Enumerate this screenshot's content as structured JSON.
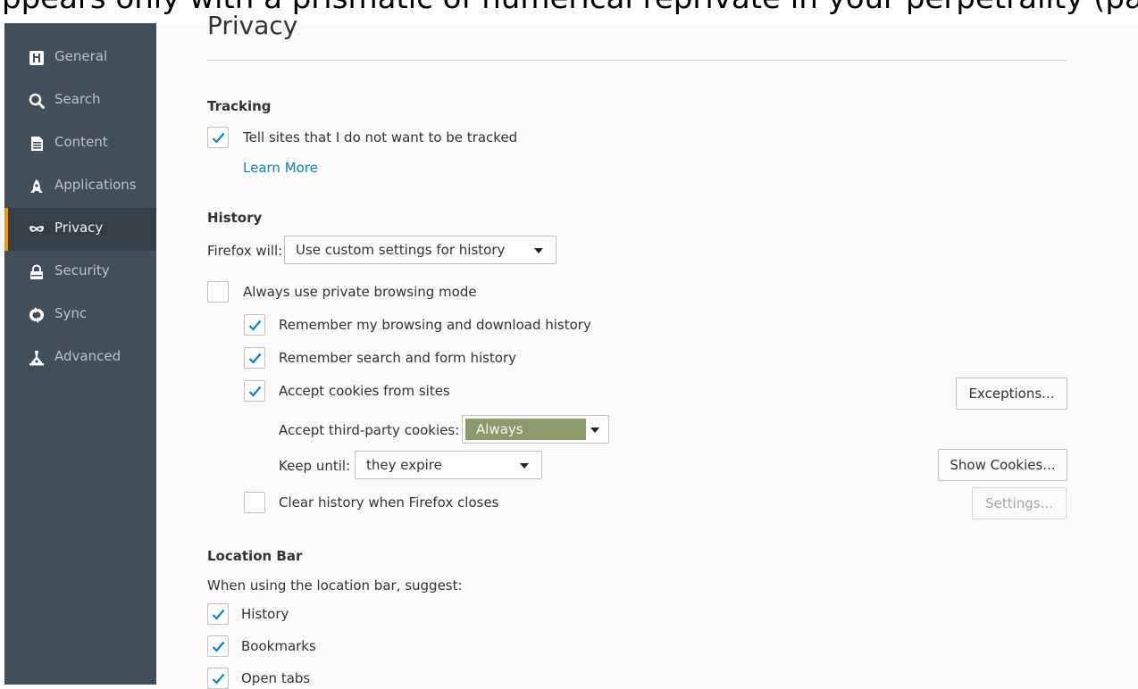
{
  "top_clipped_text": "ppears only with a prismatic of numerical reprivate in your perpetrality (pa",
  "sidebar": {
    "items": [
      {
        "label": "General",
        "icon": "general-icon"
      },
      {
        "label": "Search",
        "icon": "search-icon"
      },
      {
        "label": "Content",
        "icon": "content-icon"
      },
      {
        "label": "Applications",
        "icon": "applications-icon"
      },
      {
        "label": "Privacy",
        "icon": "privacy-mask-icon",
        "selected": true
      },
      {
        "label": "Security",
        "icon": "security-lock-icon"
      },
      {
        "label": "Sync",
        "icon": "sync-icon"
      },
      {
        "label": "Advanced",
        "icon": "advanced-icon"
      }
    ]
  },
  "page": {
    "title": "Privacy"
  },
  "tracking": {
    "heading": "Tracking",
    "dnt_label": "Tell sites that I do not want to be tracked",
    "dnt_checked": true,
    "learn_more": "Learn More"
  },
  "history": {
    "heading": "History",
    "firefox_will_label": "Firefox will:",
    "firefox_will_value": "Use custom settings for history",
    "private_mode_label": "Always use private browsing mode",
    "private_mode_checked": false,
    "remember_browsing_label": "Remember my browsing and download history",
    "remember_browsing_checked": true,
    "remember_search_label": "Remember search and form history",
    "remember_search_checked": true,
    "accept_cookies_label": "Accept cookies from sites",
    "accept_cookies_checked": true,
    "exceptions_button": "Exceptions...",
    "third_party_label": "Accept third-party cookies:",
    "third_party_value": "Always",
    "keep_until_label": "Keep until:",
    "keep_until_value": "they expire",
    "show_cookies_button": "Show Cookies...",
    "clear_history_label": "Clear history when Firefox closes",
    "clear_history_checked": false,
    "settings_button": "Settings..."
  },
  "location_bar": {
    "heading": "Location Bar",
    "subtitle": "When using the location bar, suggest:",
    "history_label": "History",
    "history_checked": true,
    "bookmarks_label": "Bookmarks",
    "bookmarks_checked": true,
    "open_tabs_label": "Open tabs",
    "open_tabs_checked": true
  },
  "colors": {
    "sidebar_bg": "#424f5a",
    "selected_bg": "#343f48",
    "selected_accent": "#ff9500",
    "link": "#0a84c4",
    "checkmark": "#0a84c4",
    "third_party_select_bg": "#8b9a6b"
  }
}
